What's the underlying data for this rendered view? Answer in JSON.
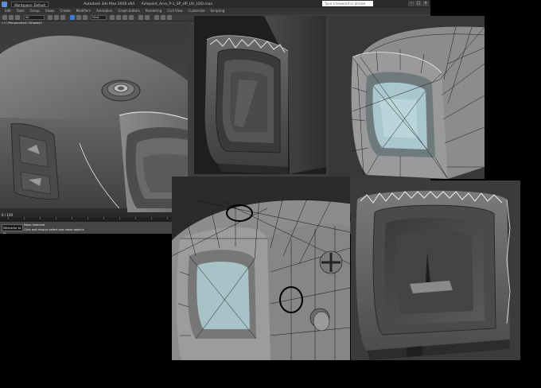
{
  "window": {
    "title_short": "Autodesk 3ds Max 2016 x64",
    "file_name": "Aimpoint_Acro_P-1_SP_HP_UV_LOD.max",
    "workspace": "Workspace: Default",
    "search_placeholder": "Type a keyword or phrase"
  },
  "menu": {
    "items": [
      "Edit",
      "Tools",
      "Group",
      "Views",
      "Create",
      "Modifiers",
      "Animation",
      "Graph Editors",
      "Rendering",
      "Civil View",
      "Customize",
      "Scripting"
    ]
  },
  "toolbar": {
    "selection_filter": "All",
    "view_dropdown": "View"
  },
  "viewport": {
    "label": "[+] [Perspective] [Shaded]"
  },
  "timeline": {
    "frame_counter": "0 / 100"
  },
  "status": {
    "maxscript_label": "Welcome to M",
    "line1": "None Selected",
    "line2": "Click and drag to select and move objects"
  },
  "colors": {
    "max_ui": "#3d3d3d",
    "background": "#000000",
    "model_gray": "#8a8a8a",
    "glass_tint": "#a9c7cc",
    "wire": "#1a1a1a"
  }
}
